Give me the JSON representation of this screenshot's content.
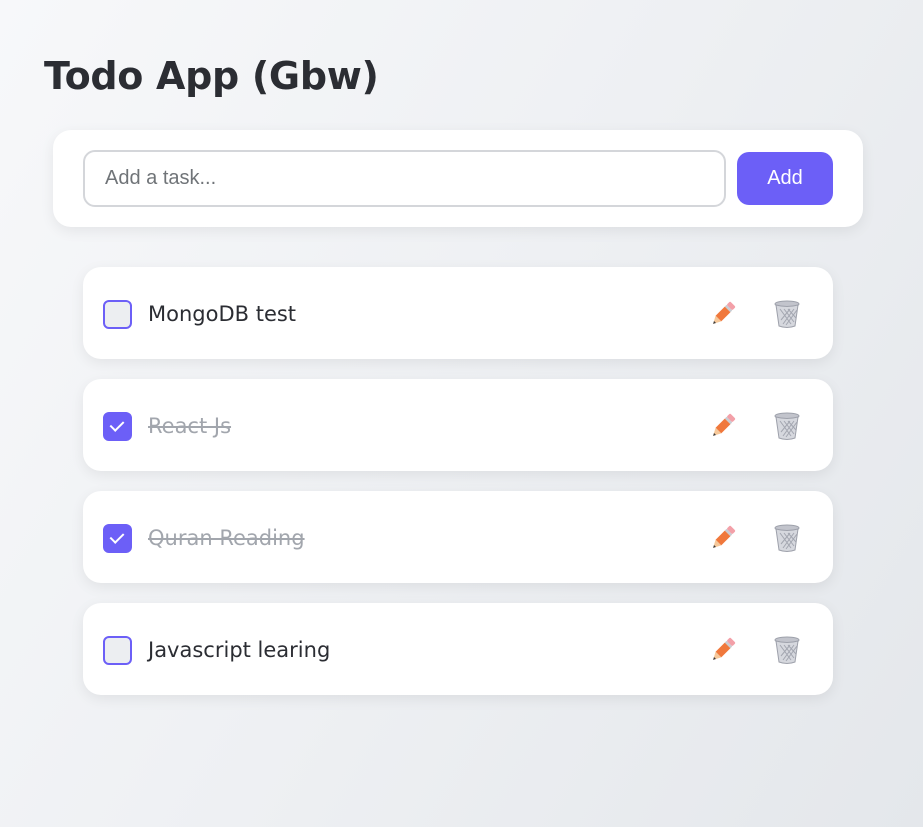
{
  "app": {
    "title": "Todo App (Gbw)"
  },
  "add_form": {
    "placeholder": "Add a task...",
    "value": "",
    "button_label": "Add"
  },
  "todos": [
    {
      "text": "MongoDB test",
      "completed": false
    },
    {
      "text": "React Js",
      "completed": true
    },
    {
      "text": "Quran Reading",
      "completed": true
    },
    {
      "text": "Javascript learing",
      "completed": false
    }
  ],
  "icons": {
    "edit": "pencil-icon",
    "delete": "wastebasket-icon"
  },
  "colors": {
    "accent": "#6c5ff7",
    "completed_text": "#a2a6ad",
    "pencil": "#f0783c"
  }
}
